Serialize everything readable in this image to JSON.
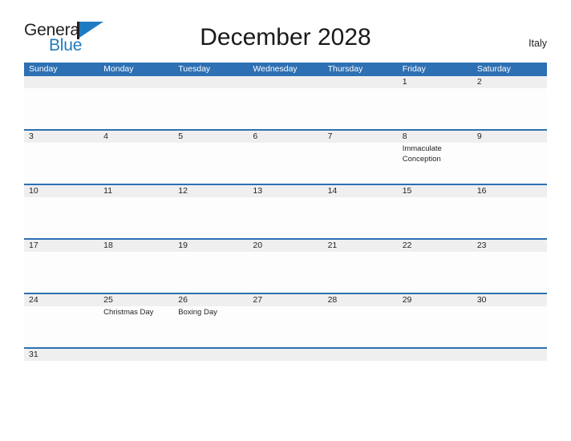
{
  "brand": {
    "name_part1": "General",
    "name_part2": "Blue",
    "flag_icon": "blue-flag-triangle",
    "color_dark": "#231f20",
    "color_blue": "#1f7bc1"
  },
  "header": {
    "title": "December 2028",
    "country": "Italy"
  },
  "theme": {
    "header_blue": "#2d70b3",
    "row_band_gray": "#efefef",
    "text_dark": "#231f20",
    "page_background": "#ffffff"
  },
  "weekdays": [
    "Sunday",
    "Monday",
    "Tuesday",
    "Wednesday",
    "Thursday",
    "Friday",
    "Saturday"
  ],
  "weeks": [
    {
      "days": [
        {
          "num": "",
          "event": ""
        },
        {
          "num": "",
          "event": ""
        },
        {
          "num": "",
          "event": ""
        },
        {
          "num": "",
          "event": ""
        },
        {
          "num": "",
          "event": ""
        },
        {
          "num": "1",
          "event": ""
        },
        {
          "num": "2",
          "event": ""
        }
      ]
    },
    {
      "days": [
        {
          "num": "3",
          "event": ""
        },
        {
          "num": "4",
          "event": ""
        },
        {
          "num": "5",
          "event": ""
        },
        {
          "num": "6",
          "event": ""
        },
        {
          "num": "7",
          "event": ""
        },
        {
          "num": "8",
          "event": "Immaculate Conception"
        },
        {
          "num": "9",
          "event": ""
        }
      ]
    },
    {
      "days": [
        {
          "num": "10",
          "event": ""
        },
        {
          "num": "11",
          "event": ""
        },
        {
          "num": "12",
          "event": ""
        },
        {
          "num": "13",
          "event": ""
        },
        {
          "num": "14",
          "event": ""
        },
        {
          "num": "15",
          "event": ""
        },
        {
          "num": "16",
          "event": ""
        }
      ]
    },
    {
      "days": [
        {
          "num": "17",
          "event": ""
        },
        {
          "num": "18",
          "event": ""
        },
        {
          "num": "19",
          "event": ""
        },
        {
          "num": "20",
          "event": ""
        },
        {
          "num": "21",
          "event": ""
        },
        {
          "num": "22",
          "event": ""
        },
        {
          "num": "23",
          "event": ""
        }
      ]
    },
    {
      "days": [
        {
          "num": "24",
          "event": ""
        },
        {
          "num": "25",
          "event": "Christmas Day"
        },
        {
          "num": "26",
          "event": "Boxing Day"
        },
        {
          "num": "27",
          "event": ""
        },
        {
          "num": "28",
          "event": ""
        },
        {
          "num": "29",
          "event": ""
        },
        {
          "num": "30",
          "event": ""
        }
      ]
    },
    {
      "days": [
        {
          "num": "31",
          "event": ""
        },
        {
          "num": "",
          "event": ""
        },
        {
          "num": "",
          "event": ""
        },
        {
          "num": "",
          "event": ""
        },
        {
          "num": "",
          "event": ""
        },
        {
          "num": "",
          "event": ""
        },
        {
          "num": "",
          "event": ""
        }
      ]
    }
  ]
}
